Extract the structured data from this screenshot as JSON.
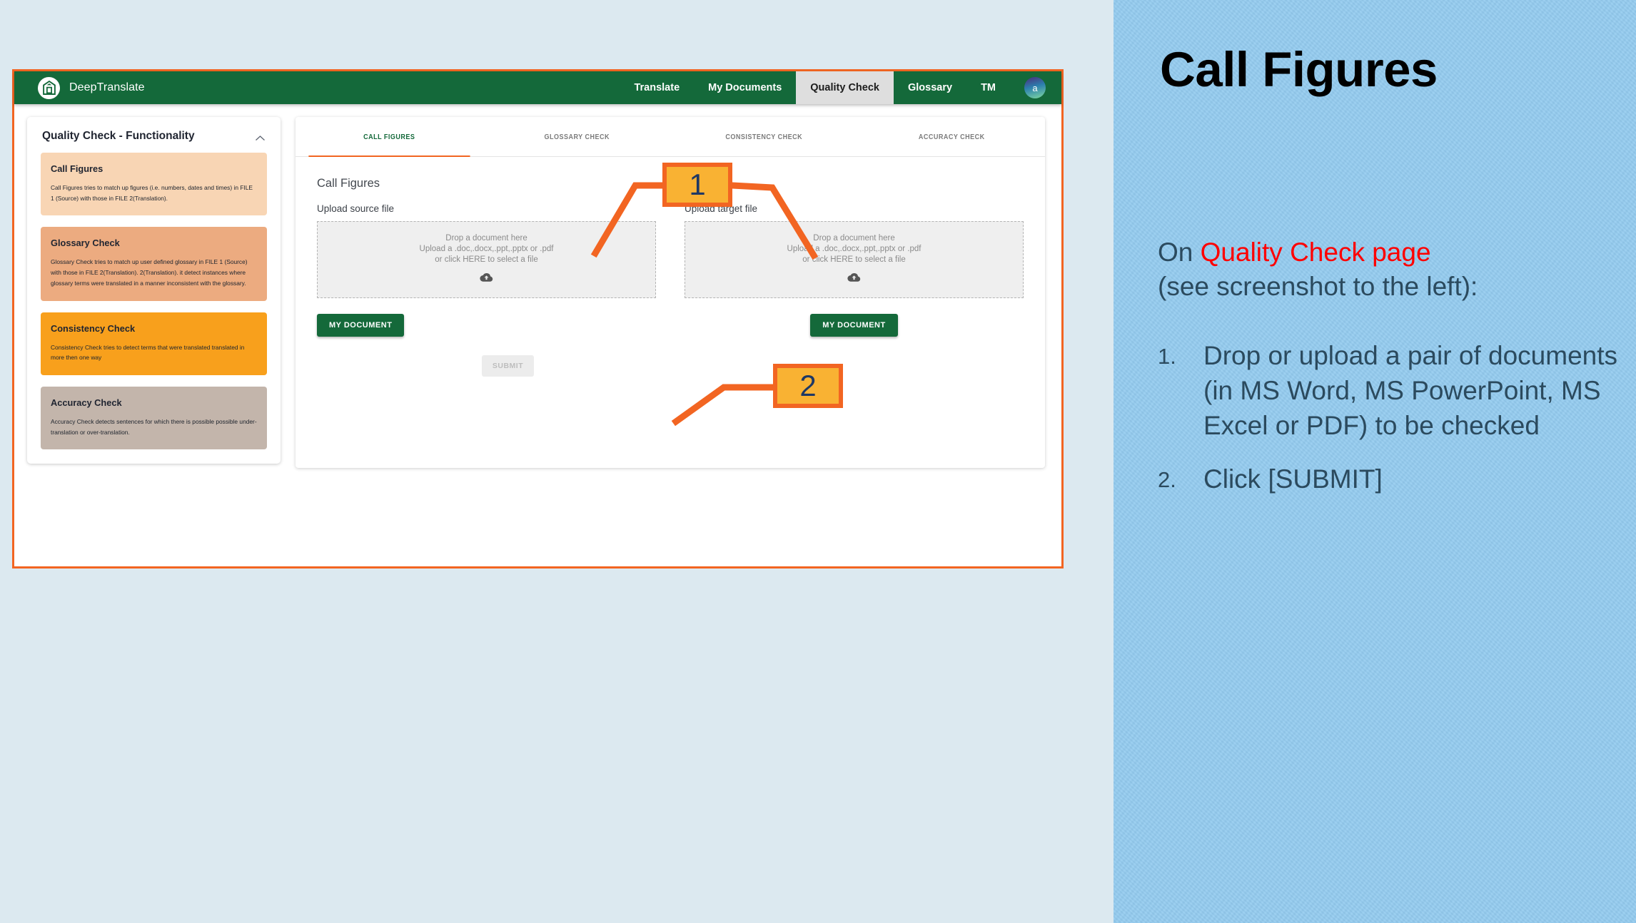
{
  "app": {
    "brand_name": "DeepTranslate",
    "logo_icon": "building-logo-icon",
    "nav": [
      {
        "label": "Translate",
        "active": false
      },
      {
        "label": "My Documents",
        "active": false
      },
      {
        "label": "Quality Check",
        "active": true
      },
      {
        "label": "Glossary",
        "active": false
      },
      {
        "label": "TM",
        "active": false
      }
    ],
    "avatar_initial": "a"
  },
  "sidebar": {
    "title": "Quality Check - Functionality",
    "collapse_icon": "chevron-up-icon",
    "cards": [
      {
        "title": "Call Figures",
        "desc": "Call Figures tries to match up figures (i.e. numbers, dates and times) in FILE 1 (Source) with those in FILE 2(Translation).",
        "color": "#f8d5b4"
      },
      {
        "title": "Glossary Check",
        "desc": "Glossary Check tries to match up user defined glossary in FILE 1 (Source) with those in FILE 2(Translation). 2(Translation). it detect instances where glossary terms were translated in a manner inconsistent with the glossary.",
        "color": "#ecab80"
      },
      {
        "title": "Consistency Check",
        "desc": "Consistency Check tries to detect terms that were translated translated in more then one way",
        "color": "#f8a01c"
      },
      {
        "title": "Accuracy Check",
        "desc": "Accuracy Check detects sentences for which there is possible possible under-translation or over-translation.",
        "color": "#c3b5ab"
      }
    ]
  },
  "main": {
    "tabs": [
      {
        "label": "CALL FIGURES",
        "active": true
      },
      {
        "label": "GLOSSARY CHECK",
        "active": false
      },
      {
        "label": "CONSISTENCY CHECK",
        "active": false
      },
      {
        "label": "ACCURACY CHECK",
        "active": false
      }
    ],
    "panel_title": "Call Figures",
    "source": {
      "label": "Upload source file",
      "drop_line1": "Drop a document here",
      "drop_line2": "Upload a .doc,.docx,.ppt,.pptx or .pdf",
      "drop_line3": "or click HERE to select a file",
      "upload_icon": "cloud-upload-icon",
      "button_label": "MY DOCUMENT"
    },
    "target": {
      "label": "Upload target file",
      "drop_line1": "Drop a document here",
      "drop_line2": "Upload a .doc,.docx,.ppt,.pptx or .pdf",
      "drop_line3": "or click HERE to select a file",
      "upload_icon": "cloud-upload-icon",
      "button_label": "MY DOCUMENT"
    },
    "submit_label": "SUBMIT"
  },
  "callouts": [
    {
      "number": "1"
    },
    {
      "number": "2"
    }
  ],
  "right_panel": {
    "title": "Call Figures",
    "lead_prefix": "On ",
    "lead_highlight": "Quality Check page",
    "lead_suffix": "(see screenshot to the left):",
    "steps": [
      {
        "num": "1.",
        "text": "Drop or upload a pair of documents (in MS Word, MS PowerPoint, MS Excel or PDF) to be checked"
      },
      {
        "num": "2.",
        "text": "Click [SUBMIT]"
      }
    ]
  },
  "colors": {
    "brand_green": "#14693a",
    "accent_orange": "#f26522",
    "callout_fill": "#f9b233",
    "callout_number": "#1f3864",
    "panel_bg": "#93cbef",
    "highlight_red": "#ff0000",
    "body_text": "#2b4a5e"
  }
}
